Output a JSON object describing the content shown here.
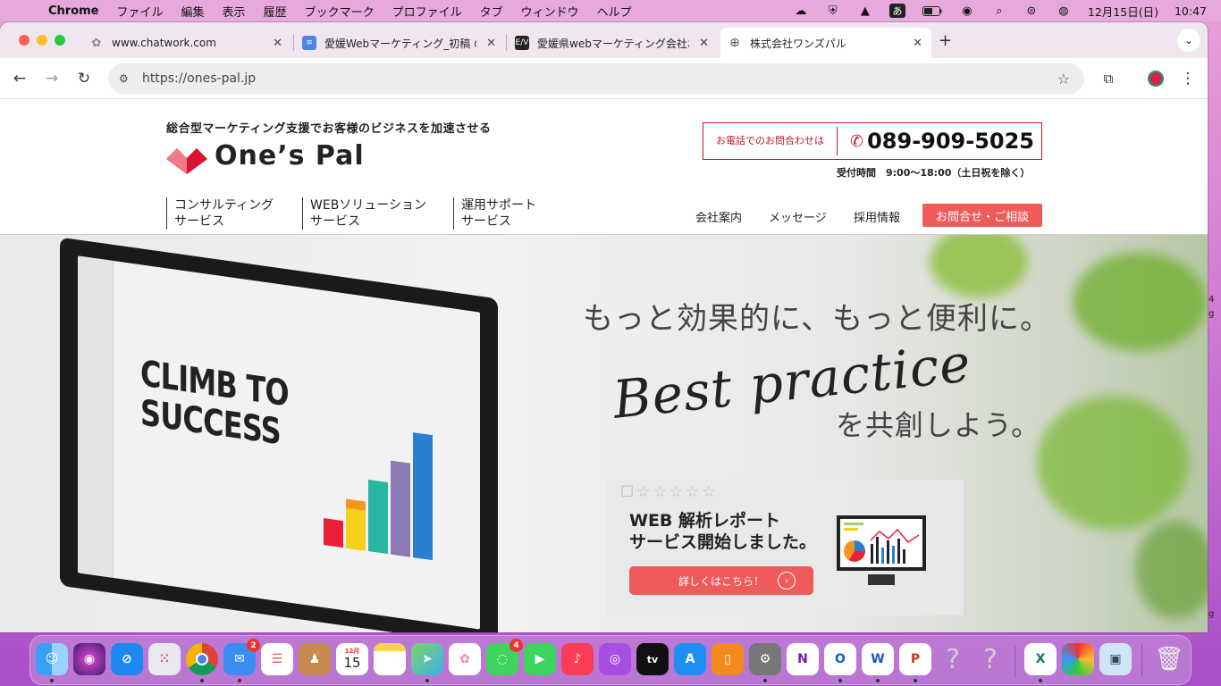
{
  "menubar": {
    "app": "Chrome",
    "items": [
      "ファイル",
      "編集",
      "表示",
      "履歴",
      "ブックマーク",
      "プロファイル",
      "タブ",
      "ウィンドウ",
      "ヘルプ"
    ],
    "ime": "あ",
    "datetime": "12月15日(日)",
    "time": "10:47"
  },
  "tabs": [
    {
      "label": "www.chatwork.com",
      "favicon": "chatwork-icon"
    },
    {
      "label": "愛媛Webマーケティング_初稿 の",
      "favicon": "google-docs-icon"
    },
    {
      "label": "愛媛県webマーケティング会社お",
      "favicon": "ew-site-icon",
      "favicon_text": "E/V"
    },
    {
      "label": "株式会社ワンズパル",
      "favicon": "globe-icon",
      "active": true
    }
  ],
  "toolbar": {
    "url": "https://ones-pal.jp"
  },
  "site": {
    "tagline": "総合型マーケティング支援でお客様のビジネスを加速させる",
    "logo": "One’s Pal",
    "phone_label": "お電話でのお問合わせは",
    "phone_number": "089-909-5025",
    "hours": "受付時間　9:00〜18:00（土日祝を除く）",
    "nav": [
      "コンサルティング\nサービス",
      "WEBソリューション\nサービス",
      "運用サポート\nサービス"
    ],
    "subnav": [
      "会社案内",
      "メッセージ",
      "採用情報"
    ],
    "contact_button": "お問合せ・ご相談",
    "hero": {
      "screen_text": "CLIMB TO\nSUCCESS",
      "copy1": "もっと効果的に、もっと便利に。",
      "script": "Best practice",
      "copy2": "を共創しよう。"
    },
    "banner": {
      "title": "WEB 解析レポート\nサービス開始しました。",
      "button": "詳しくはこちら！"
    }
  },
  "dock": {
    "calendar_month": "12月",
    "calendar_day": "15",
    "mail_badge": "2",
    "messages_badge": "4"
  },
  "edge": {
    "right_fragment_1": "4",
    "right_fragment_2": "g",
    "right_fragment_3": "g"
  }
}
